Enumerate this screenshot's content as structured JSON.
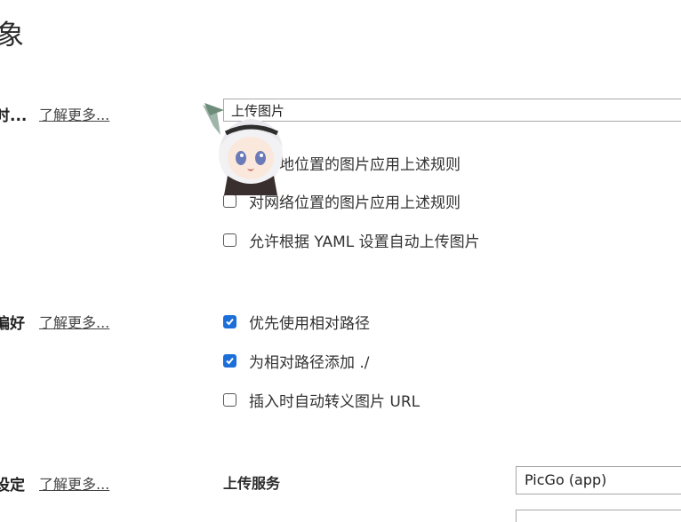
{
  "page": {
    "title": "象"
  },
  "sections": [
    {
      "label": "时...",
      "learn_more": "了解更多..."
    },
    {
      "label": "偏好",
      "learn_more": "了解更多..."
    },
    {
      "label": "设定",
      "learn_more": "了解更多..."
    }
  ],
  "upload_action": {
    "value": "上传图片"
  },
  "upload_options": [
    {
      "label": "对本地位置的图片应用上述规则",
      "checked": false
    },
    {
      "label": "对网络位置的图片应用上述规则",
      "checked": false
    },
    {
      "label": "允许根据 YAML 设置自动上传图片",
      "checked": false
    }
  ],
  "path_options": [
    {
      "label": "优先使用相对路径",
      "checked": true
    },
    {
      "label": "为相对路径添加 ./",
      "checked": true
    },
    {
      "label": "插入时自动转义图片 URL",
      "checked": false
    }
  ],
  "upload_service": {
    "label": "上传服务",
    "selected": "PicGo (app)"
  },
  "colors": {
    "checkbox_checked": "#1c6fd8",
    "border": "#a8a8a8"
  }
}
